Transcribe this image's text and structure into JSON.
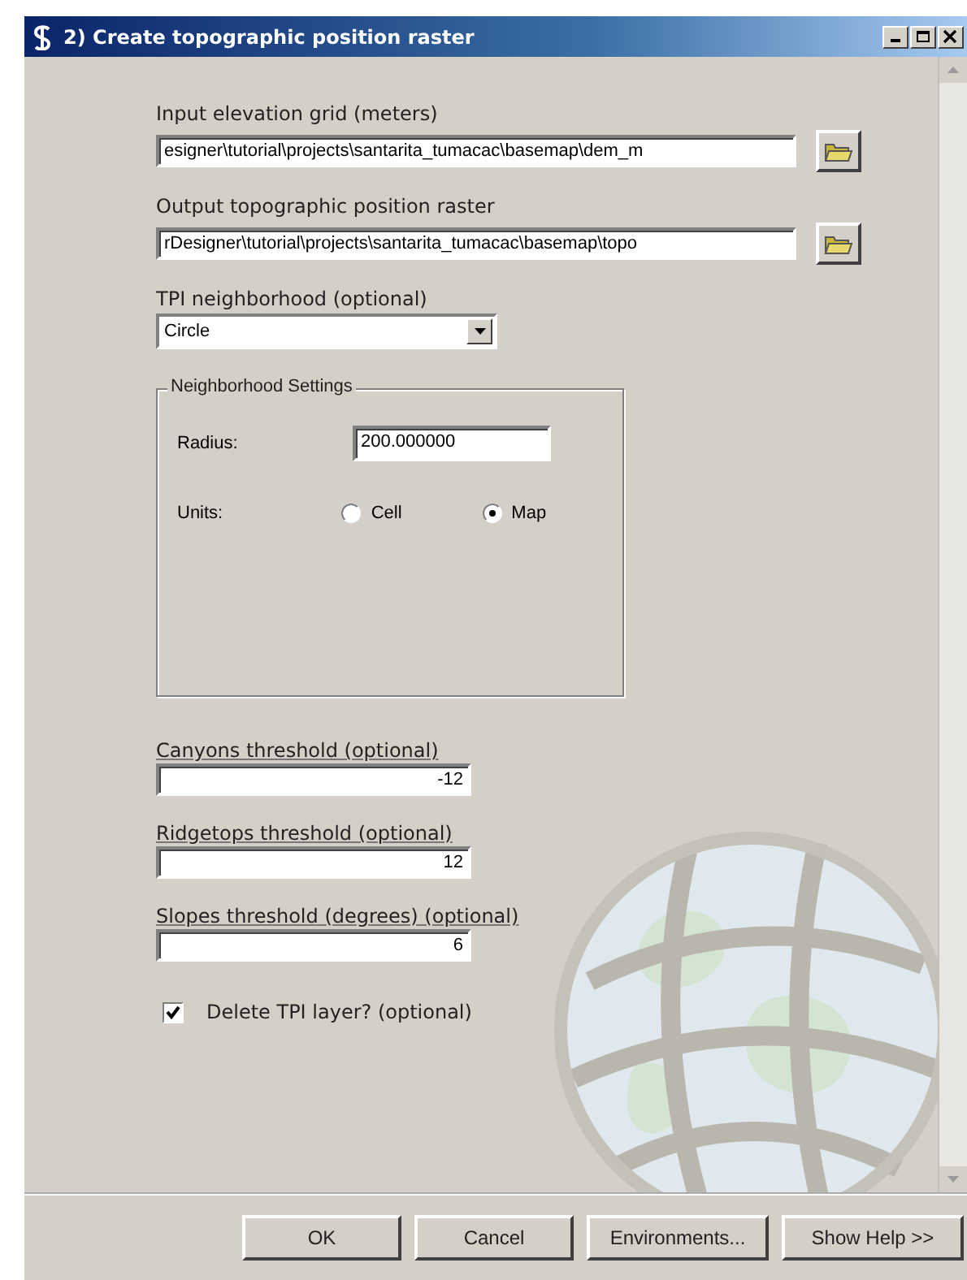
{
  "window": {
    "title": "2) Create topographic position raster"
  },
  "paths": [
    {
      "label": "Input elevation grid (meters)",
      "value": "esigner\\tutorial\\projects\\santarita_tumacac\\basemap\\dem_m"
    },
    {
      "label": "Output topographic position raster",
      "value": "rDesigner\\tutorial\\projects\\santarita_tumacac\\basemap\\topo"
    }
  ],
  "neighborhood": {
    "label": "TPI neighborhood (optional)",
    "value": "Circle"
  },
  "settings": {
    "title": "Neighborhood Settings",
    "radius_label": "Radius:",
    "radius": "200.000000",
    "units_label": "Units:",
    "units": [
      {
        "label": "Cell",
        "selected": false
      },
      {
        "label": "Map",
        "selected": true
      }
    ]
  },
  "thresholds": [
    {
      "label": "Canyons threshold (optional)",
      "value": "-12"
    },
    {
      "label": "Ridgetops threshold (optional)",
      "value": "12"
    },
    {
      "label": "Slopes threshold (degrees) (optional)",
      "value": "6"
    }
  ],
  "delete_layer": {
    "label": "Delete TPI layer? (optional)",
    "checked": true
  },
  "buttons": [
    "OK",
    "Cancel",
    "Environments...",
    "Show Help >>"
  ]
}
